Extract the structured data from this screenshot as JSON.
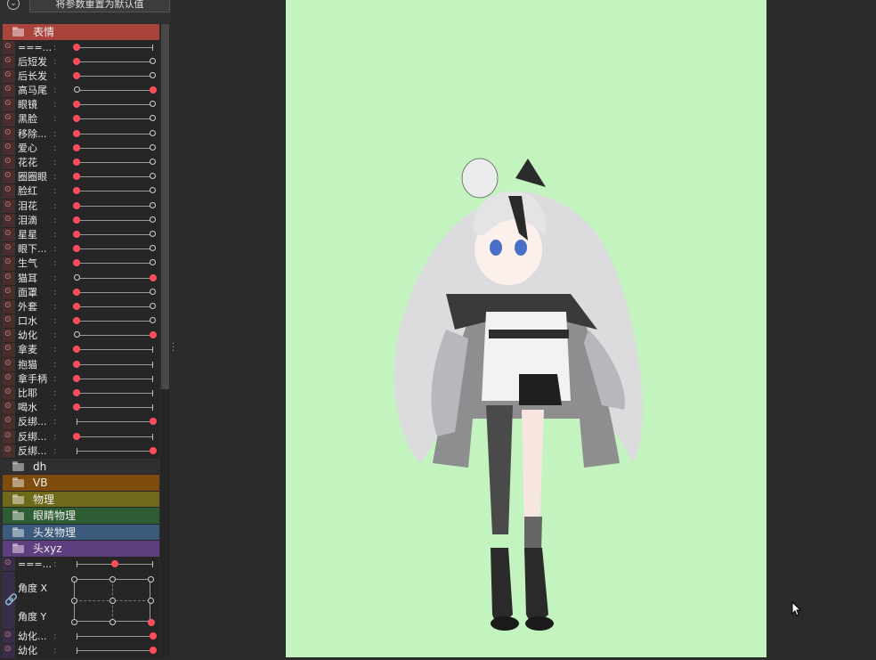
{
  "toolbar": {
    "reset_label": "将参数重置为默认值"
  },
  "groups": {
    "expression": "表情",
    "dh": "dh",
    "vb": "VB",
    "physics": "物理",
    "eye_physics": "眼睛物理",
    "hair_physics": "头发物理",
    "head_xyz": "头xyz"
  },
  "expression_params": [
    {
      "label": "===...",
      "value": 0,
      "type": "bar"
    },
    {
      "label": "后短发",
      "value": 0,
      "type": "toggle"
    },
    {
      "label": "后长发",
      "value": 0,
      "type": "toggle"
    },
    {
      "label": "高马尾",
      "value": 1,
      "type": "toggle"
    },
    {
      "label": "眼镜",
      "value": 0,
      "type": "toggle"
    },
    {
      "label": "黑脸",
      "value": 0,
      "type": "toggle"
    },
    {
      "label": "移除...",
      "value": 0,
      "type": "toggle"
    },
    {
      "label": "爱心",
      "value": 0,
      "type": "toggle"
    },
    {
      "label": "花花",
      "value": 0,
      "type": "toggle"
    },
    {
      "label": "圈圈眼",
      "value": 0,
      "type": "toggle"
    },
    {
      "label": "脸红",
      "value": 0,
      "type": "toggle"
    },
    {
      "label": "泪花",
      "value": 0,
      "type": "toggle"
    },
    {
      "label": "泪滴",
      "value": 0,
      "type": "toggle"
    },
    {
      "label": "星星",
      "value": 0,
      "type": "toggle"
    },
    {
      "label": "眼下...",
      "value": 0,
      "type": "toggle"
    },
    {
      "label": "生气",
      "value": 0,
      "type": "toggle"
    },
    {
      "label": "猫耳",
      "value": 1,
      "type": "toggle"
    },
    {
      "label": "面罩",
      "value": 0,
      "type": "toggle"
    },
    {
      "label": "外套",
      "value": 0,
      "type": "toggle"
    },
    {
      "label": "口水",
      "value": 0,
      "type": "toggle"
    },
    {
      "label": "幼化",
      "value": 1,
      "type": "toggle"
    },
    {
      "label": "拿麦",
      "value": 0,
      "type": "bar"
    },
    {
      "label": "抱猫",
      "value": 0,
      "type": "bar"
    },
    {
      "label": "拿手柄",
      "value": 0,
      "type": "bar"
    },
    {
      "label": "比耶",
      "value": 0,
      "type": "bar"
    },
    {
      "label": "喝水",
      "value": 0,
      "type": "bar"
    },
    {
      "label": "反绑...",
      "value": 1,
      "type": "bar"
    },
    {
      "label": "反绑...",
      "value": 0,
      "type": "bar"
    },
    {
      "label": "反绑...",
      "value": 1,
      "type": "bar"
    }
  ],
  "head_params": {
    "separator": {
      "label": "===...",
      "value": 0.5
    },
    "angle_x": "角度 X",
    "angle_y": "角度 Y",
    "angle_value": {
      "x": 1,
      "y": 0
    },
    "extra": [
      {
        "label": "幼化...",
        "value": 1
      },
      {
        "label": "幼化",
        "value": 1
      }
    ]
  },
  "colors": {
    "expression": "#a8443c",
    "dh": "#2f2f2f",
    "vb": "#7e4d0e",
    "physics": "#6e6a1a",
    "eye_physics": "#2f5d33",
    "hair_physics": "#3c5a7c",
    "head_xyz": "#5d3f80",
    "canvas_bg": "#c3f4c0",
    "knob": "#ff4d5c"
  },
  "icons": [
    "chevron-down-icon",
    "folder-icon",
    "clip-icon",
    "link-icon",
    "cursor-icon",
    "grip-icon"
  ]
}
